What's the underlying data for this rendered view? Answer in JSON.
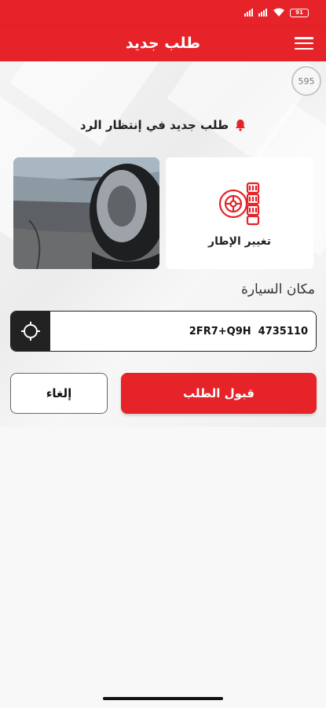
{
  "app_bar": {
    "title": "طلب جديد"
  },
  "counter": {
    "value": "595"
  },
  "notice": {
    "text": "طلب جديد في إنتظار الرد"
  },
  "service": {
    "label": "تغيير الإطار",
    "icon": "tire-change-icon"
  },
  "location": {
    "label": "مكان السيارة",
    "value": "2FR7+Q9H  4735110"
  },
  "actions": {
    "accept_label": "قبول الطلب",
    "cancel_label": "إلغاء"
  },
  "status_bar": {
    "battery": "91"
  },
  "colors": {
    "brand": "#e52328",
    "dark": "#222222"
  }
}
